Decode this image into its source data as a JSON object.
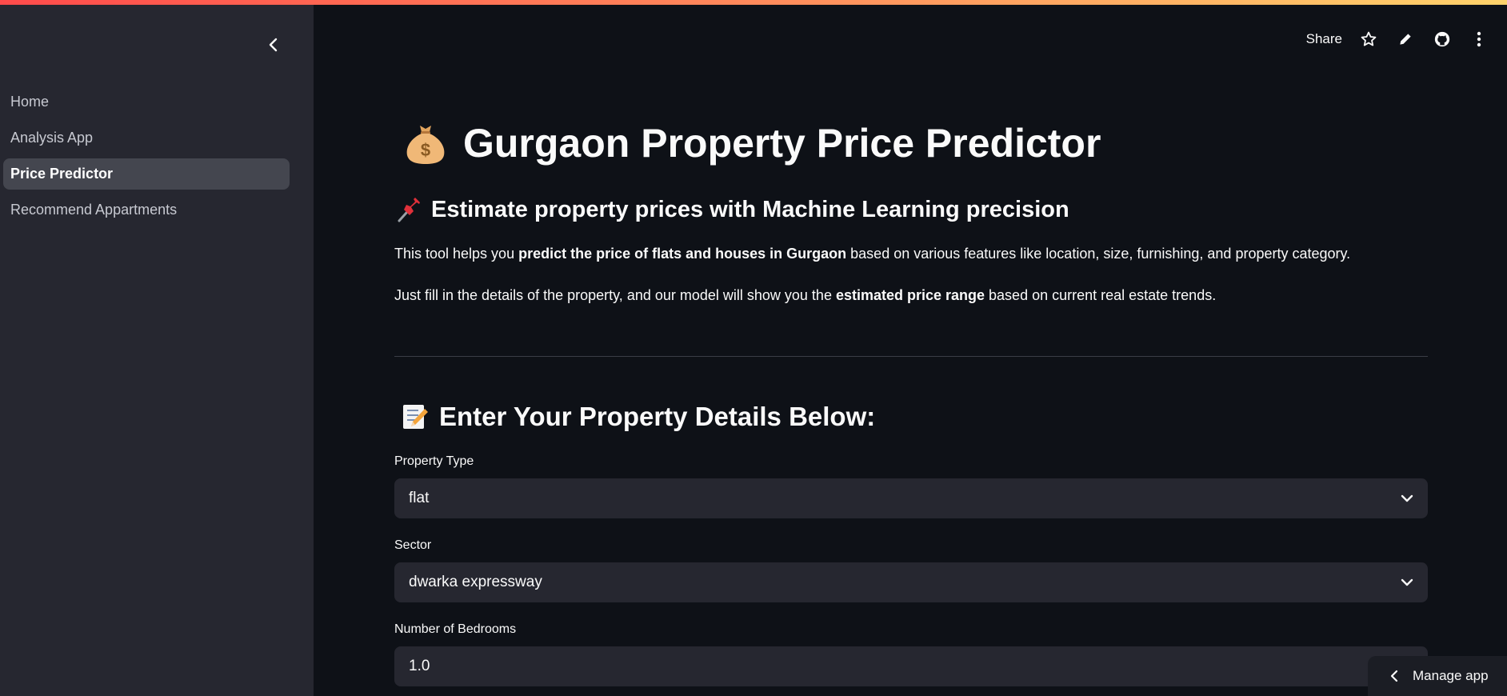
{
  "sidebar": {
    "items": [
      {
        "label": "Home",
        "active": false
      },
      {
        "label": "Analysis App",
        "active": false
      },
      {
        "label": "Price Predictor",
        "active": true
      },
      {
        "label": "Recommend Appartments",
        "active": false
      }
    ]
  },
  "header": {
    "share_label": "Share",
    "icons": [
      "star-icon",
      "pencil-icon",
      "github-icon",
      "more-vertical-icon"
    ]
  },
  "main": {
    "title": "Gurgaon Property Price Predictor",
    "subtitle": "Estimate property prices with Machine Learning precision",
    "para1": {
      "pre": "This tool helps you ",
      "bold": "predict the price of flats and houses in Gurgaon",
      "post": " based on various features like location, size, furnishing, and property category."
    },
    "para2": {
      "pre": "Just fill in the details of the property, and our model will show you the ",
      "bold": "estimated price range",
      "post": " based on current real estate trends."
    },
    "section_title": "Enter Your Property Details Below:",
    "fields": [
      {
        "label": "Property Type",
        "value": "flat"
      },
      {
        "label": "Sector",
        "value": "dwarka expressway"
      },
      {
        "label": "Number of Bedrooms",
        "value": "1.0"
      }
    ]
  },
  "manage_app_label": "Manage app",
  "colors": {
    "background": "#0e1117",
    "sidebar": "#262730",
    "input": "#262730",
    "accent_gradient": [
      "#ff4b4b",
      "#ffd36b"
    ]
  }
}
